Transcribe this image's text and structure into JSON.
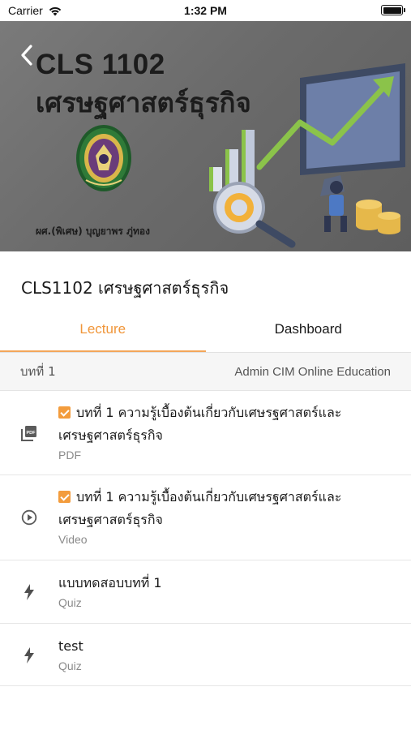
{
  "status_bar": {
    "carrier": "Carrier",
    "time": "1:32 PM"
  },
  "banner": {
    "course_code": "CLS 1102",
    "course_name": "เศรษฐศาสตร์ธุรกิจ",
    "author": "ผศ.(พิเศษ) บุญยาพร ภู่ทอง"
  },
  "course": {
    "title": "CLS1102 เศรษฐศาสตร์ธุรกิจ"
  },
  "tabs": [
    {
      "label": "Lecture",
      "active": true
    },
    {
      "label": "Dashboard",
      "active": false
    }
  ],
  "section": {
    "chapter": "บทที่ 1",
    "owner": "Admin CIM Online Education"
  },
  "items": [
    {
      "icon": "pdf-icon",
      "completed": true,
      "title_line1": "บทที่ 1 ความรู้เบื้องต้นเกี่ยวกับเศษรฐศาสตร์และ",
      "title_line2": "เศรษฐศาสตร์ธุรกิจ",
      "type": "PDF"
    },
    {
      "icon": "play-circle-icon",
      "completed": true,
      "title_line1": "บทที่ 1 ความรู้เบื้องต้นเกี่ยวกับเศษรฐศาสตร์และ",
      "title_line2": "เศรษฐศาสตร์ธุรกิจ",
      "type": "Video"
    },
    {
      "icon": "lightning-icon",
      "completed": false,
      "title_line1": "แบบทดสอบบทที่ 1",
      "type": "Quiz"
    },
    {
      "icon": "lightning-icon",
      "completed": false,
      "title_line1": "test",
      "type": "Quiz"
    }
  ],
  "colors": {
    "accent": "#f0963a",
    "checkbox": "#f39c3d",
    "banner_bg": "#6e6e6e"
  }
}
